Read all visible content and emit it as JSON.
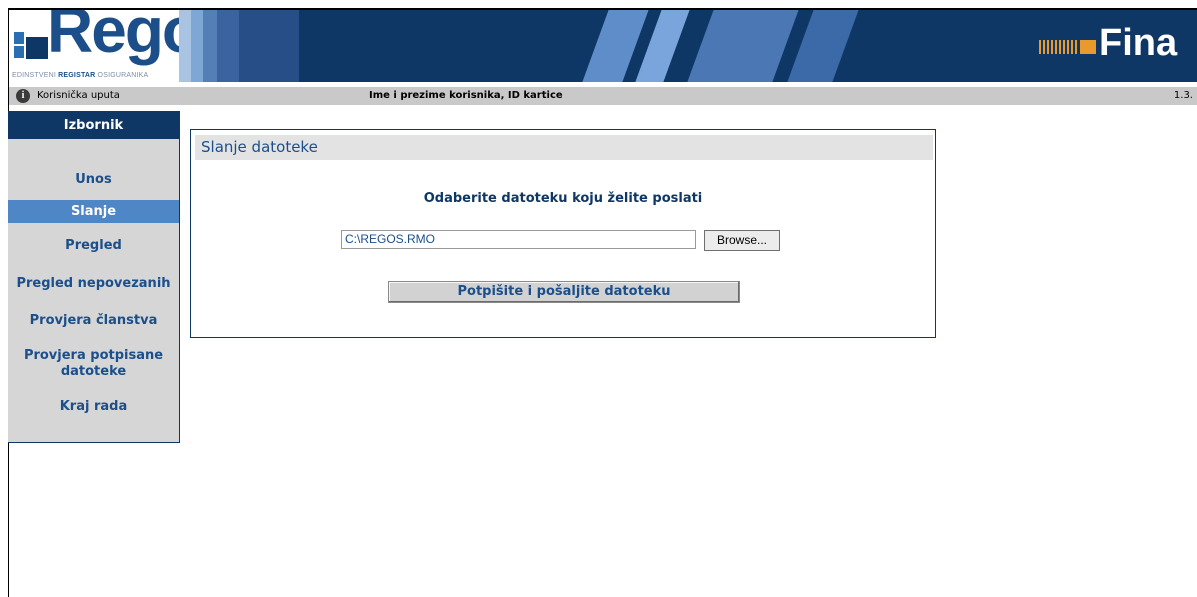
{
  "header": {
    "logo_text": "Regos",
    "logo_subtitle_pre": "EDINSTVENI ",
    "logo_subtitle_bold": "REGISTAR",
    "logo_subtitle_post": " OSIGURANIKA",
    "partner_logo": "Fina"
  },
  "statusbar": {
    "help_icon": "info-icon",
    "help_label": "Korisnička uputa",
    "user_info": "Ime i prezime korisnika, ID kartice",
    "version": "1.3."
  },
  "sidebar": {
    "title": "Izbornik",
    "items": [
      {
        "label": "Unos"
      },
      {
        "label": "Slanje",
        "active": true
      },
      {
        "label": "Pregled"
      },
      {
        "label": "Pregled nepovezanih"
      },
      {
        "label": "Provjera članstva"
      },
      {
        "label": "Provjera potpisane datoteke"
      },
      {
        "label": "Kraj rada"
      }
    ]
  },
  "main": {
    "panel_title": "Slanje datoteke",
    "prompt": "Odaberite datoteku koju želite poslati",
    "file_value": "C:\\REGOS.RMO",
    "browse_label": "Browse...",
    "submit_label": "Potpišite i pošaljite datoteku"
  },
  "colors": {
    "brand_dark": "#0f3766",
    "brand_blue": "#1c4f8a",
    "active_item": "#4f86c6",
    "fina_orange": "#e89b2c"
  }
}
